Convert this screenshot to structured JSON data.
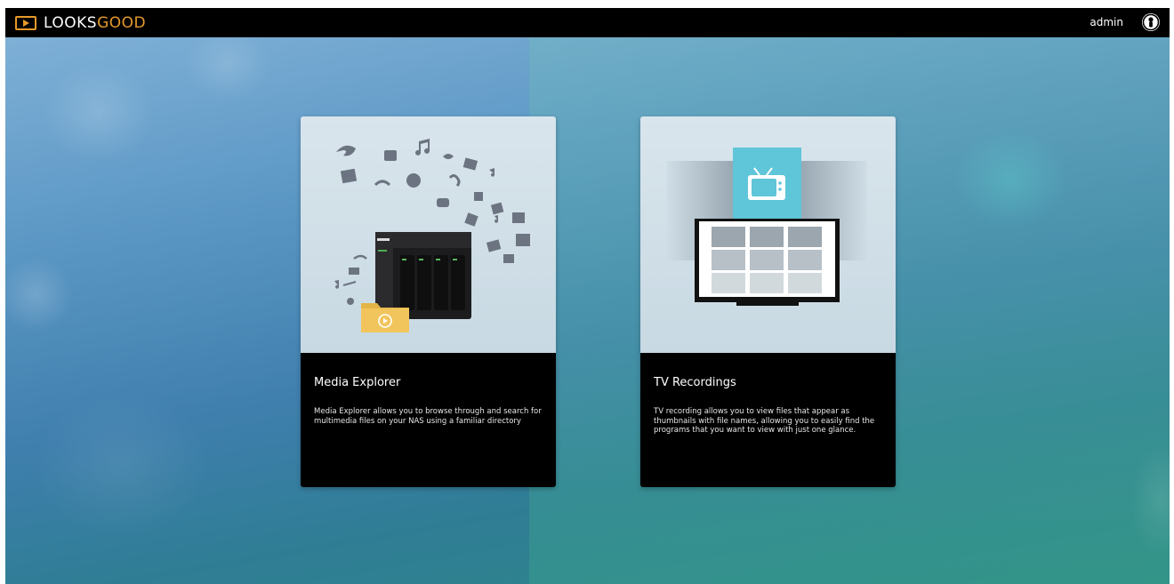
{
  "app": {
    "logo_text_main": "LOOKS",
    "logo_text_accent": "GOOD",
    "user_name": "admin",
    "brand_color": "#e69a2a"
  },
  "icons": {
    "logo": "play-icon",
    "user": "user-icon",
    "tv": "tv-icon",
    "folder": "folder-icon",
    "nas": "nas-device-icon"
  },
  "cards": {
    "media_explorer": {
      "title": "Media Explorer",
      "description": "Media Explorer allows you to browse through and search for multimedia files on your NAS using a familiar directory"
    },
    "tv_recordings": {
      "title": "TV Recordings",
      "description": "TV recording allows you to view files that appear as thumbnails with file names, allowing you to easily find the programs that you want to view with just one glance."
    }
  }
}
